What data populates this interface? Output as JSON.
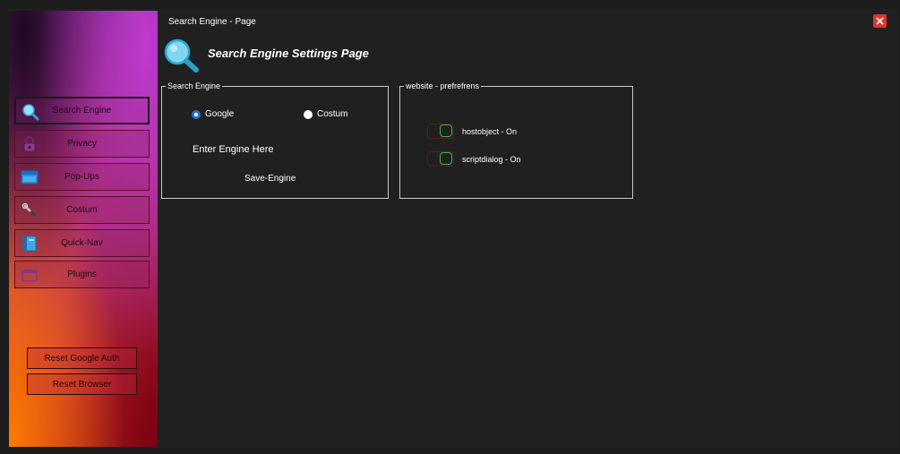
{
  "window": {
    "title": "Search Engine - Page",
    "heading": "Search Engine Settings Page"
  },
  "icons": {
    "header": "magnifier-icon",
    "close": "close-icon"
  },
  "colors": {
    "accent_blue": "#2d6fd8",
    "close_red": "#e0352b",
    "toggle_on_green": "#2fbf2f"
  },
  "sidebar": {
    "items": [
      {
        "label": "Search Engine",
        "icon": "magnifier-icon",
        "active": true
      },
      {
        "label": "Privacy",
        "icon": "lock-icon",
        "active": false
      },
      {
        "label": "Pop-Ups",
        "icon": "window-icon",
        "active": false
      },
      {
        "label": "Costum",
        "icon": "wrench-icon",
        "active": false
      },
      {
        "label": "Quick-Nav",
        "icon": "book-icon",
        "active": false
      },
      {
        "label": "Plugins",
        "icon": "plugin-icon",
        "active": false
      }
    ],
    "buttons": {
      "reset_google": "Reset Google Auth",
      "reset_browser": "Reset Browser"
    }
  },
  "engine_group": {
    "title": "Search Engine",
    "options": [
      {
        "label": "Google",
        "selected": true
      },
      {
        "label": "Costum",
        "selected": false
      }
    ],
    "input_placeholder": "Enter Engine Here",
    "save_label": "Save-Engine"
  },
  "prefs_group": {
    "title": "website - prefrefrens",
    "toggles": [
      {
        "label": "hostobject - On",
        "on": true
      },
      {
        "label": "scriptdialog - On",
        "on": true
      }
    ]
  }
}
